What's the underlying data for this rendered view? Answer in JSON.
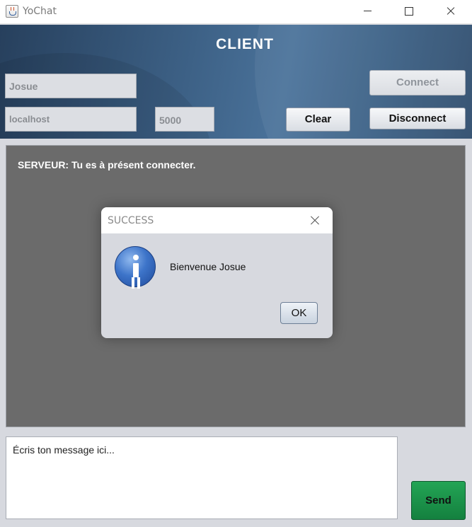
{
  "window": {
    "title": "YoChat",
    "icon": "java-app-icon",
    "controls": [
      "minimize-icon",
      "maximize-icon",
      "close-icon"
    ]
  },
  "header": {
    "title": "CLIENT",
    "name_value": "Josue",
    "host_value": "localhost",
    "port_value": "5000",
    "clear_label": "Clear",
    "connect_label": "Connect",
    "disconnect_label": "Disconnect",
    "connect_enabled": false
  },
  "chat": {
    "messages": [
      "SERVEUR: Tu es à présent connecter."
    ]
  },
  "composer": {
    "message_text": "Écris ton message ici...",
    "send_label": "Send",
    "send_color": "#1a9148"
  },
  "dialog": {
    "title": "SUCCESS",
    "icon": "info-icon",
    "message": "Bienvenue Josue",
    "ok_label": "OK"
  },
  "colors": {
    "header_bg": "#3d6186",
    "chat_bg": "#6b6b6b",
    "window_bg": "#d7d9df"
  }
}
